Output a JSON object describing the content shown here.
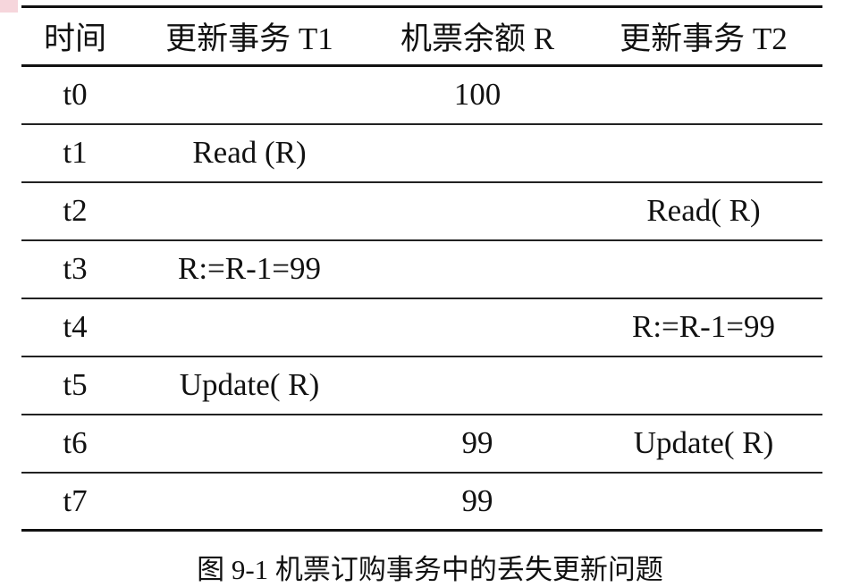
{
  "table": {
    "headers": [
      "时间",
      "更新事务 T1",
      "机票余额 R",
      "更新事务 T2"
    ],
    "rows": [
      [
        "t0",
        "",
        "100",
        ""
      ],
      [
        "t1",
        "Read (R)",
        "",
        ""
      ],
      [
        "t2",
        "",
        "",
        "Read( R)"
      ],
      [
        "t3",
        "R:=R-1=99",
        "",
        ""
      ],
      [
        "t4",
        "",
        "",
        "R:=R-1=99"
      ],
      [
        "t5",
        "Update( R)",
        "",
        ""
      ],
      [
        "t6",
        "",
        "99",
        "Update( R)"
      ],
      [
        "t7",
        "",
        "99",
        ""
      ]
    ]
  },
  "caption": "图 9-1  机票订购事务中的丢失更新问题"
}
